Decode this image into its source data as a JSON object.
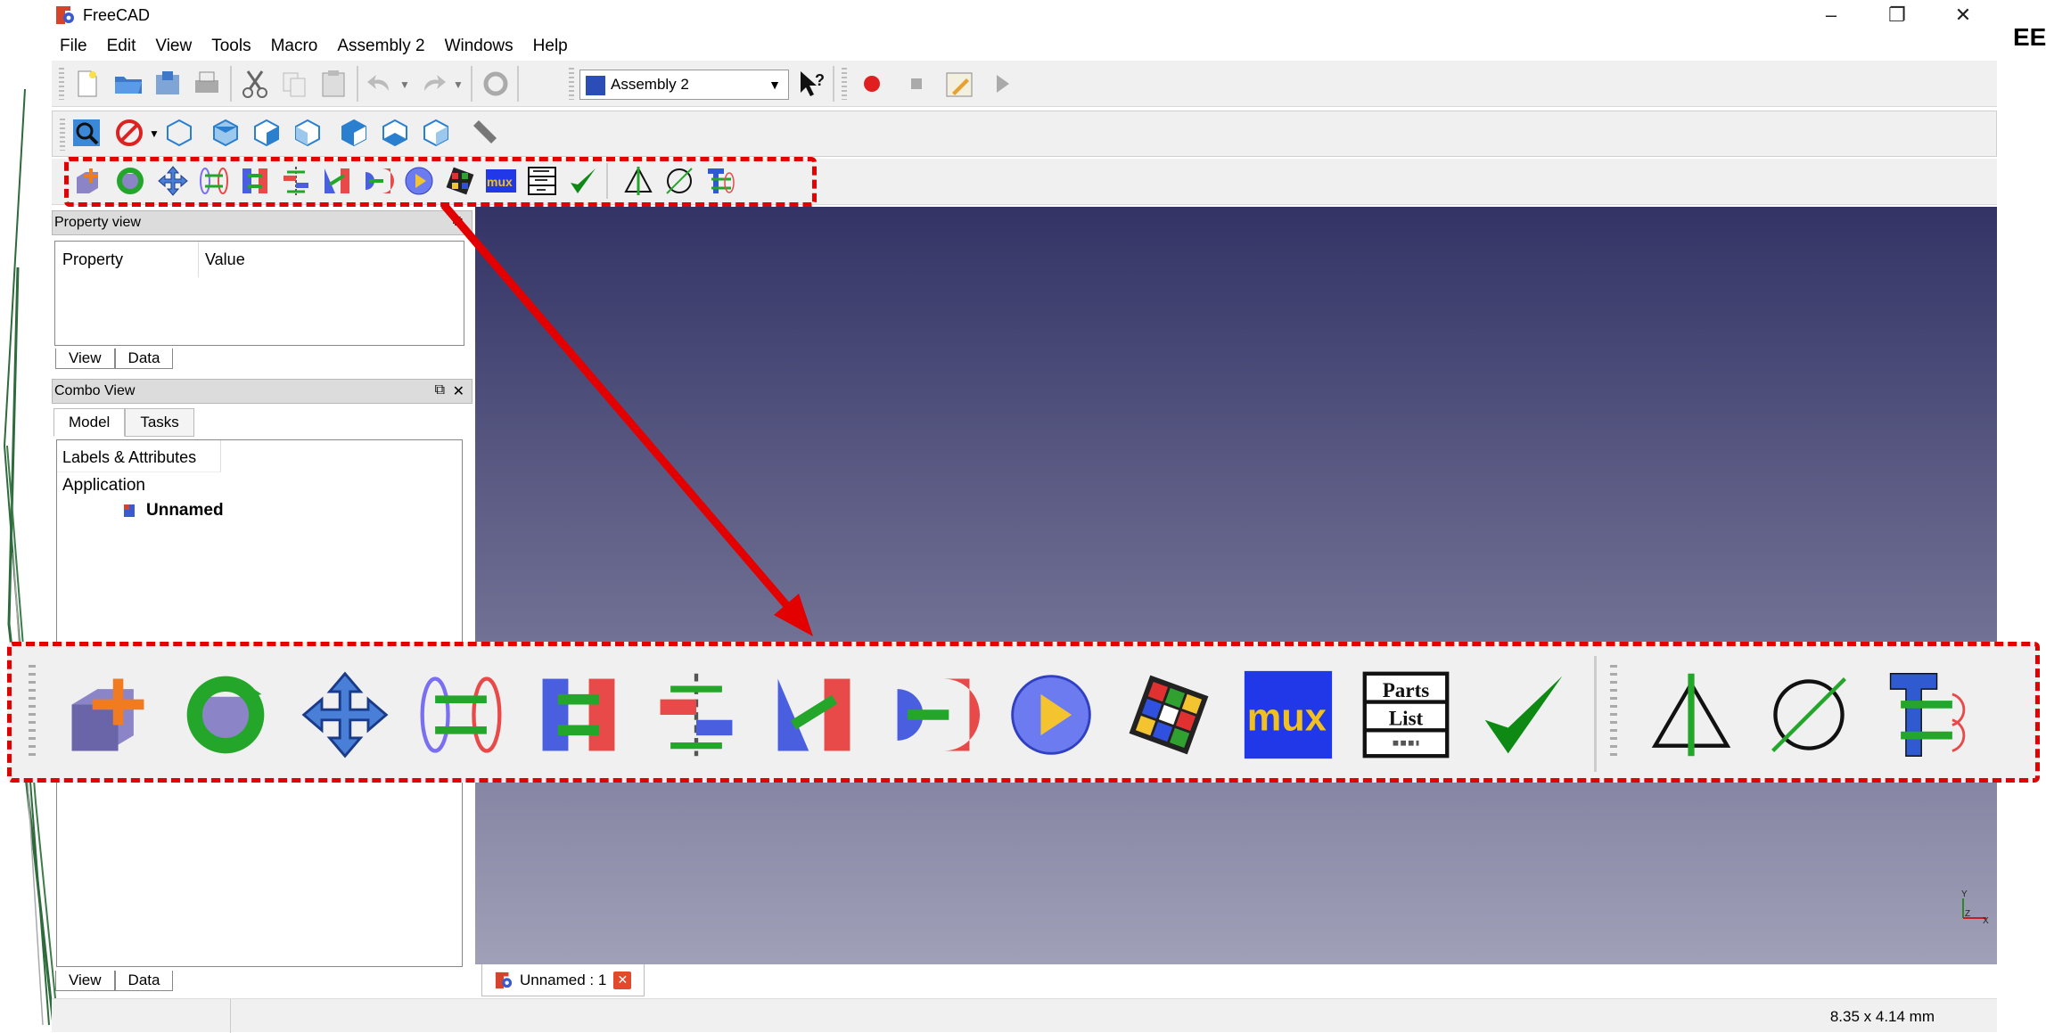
{
  "app": {
    "title": "FreeCAD",
    "corner_text": "EE"
  },
  "menu": [
    "File",
    "Edit",
    "View",
    "Tools",
    "Macro",
    "Assembly 2",
    "Windows",
    "Help"
  ],
  "toolbar": {
    "workbench": "Assembly 2"
  },
  "property_view": {
    "title": "Property view",
    "col_property": "Property",
    "col_value": "Value",
    "tab_view": "View",
    "tab_data": "Data"
  },
  "combo_view": {
    "title": "Combo View",
    "tab_model": "Model",
    "tab_tasks": "Tasks",
    "tree_header": "Labels & Attributes",
    "tree_root": "Application",
    "tree_doc": "Unnamed",
    "tab_view": "View",
    "tab_data": "Data"
  },
  "document_tab": "Unnamed : 1",
  "status": {
    "size": "8.35 x 4.14 mm"
  },
  "viewport_axes": {
    "y": "Y",
    "z": "Z",
    "x": "X"
  },
  "big_icons": {
    "mux_label": "mux",
    "parts_top": "Parts",
    "parts_bottom": "List"
  },
  "colors": {
    "highlight": "#e30000",
    "viewport_top": "#333366",
    "viewport_bottom": "#a0a0b8"
  }
}
